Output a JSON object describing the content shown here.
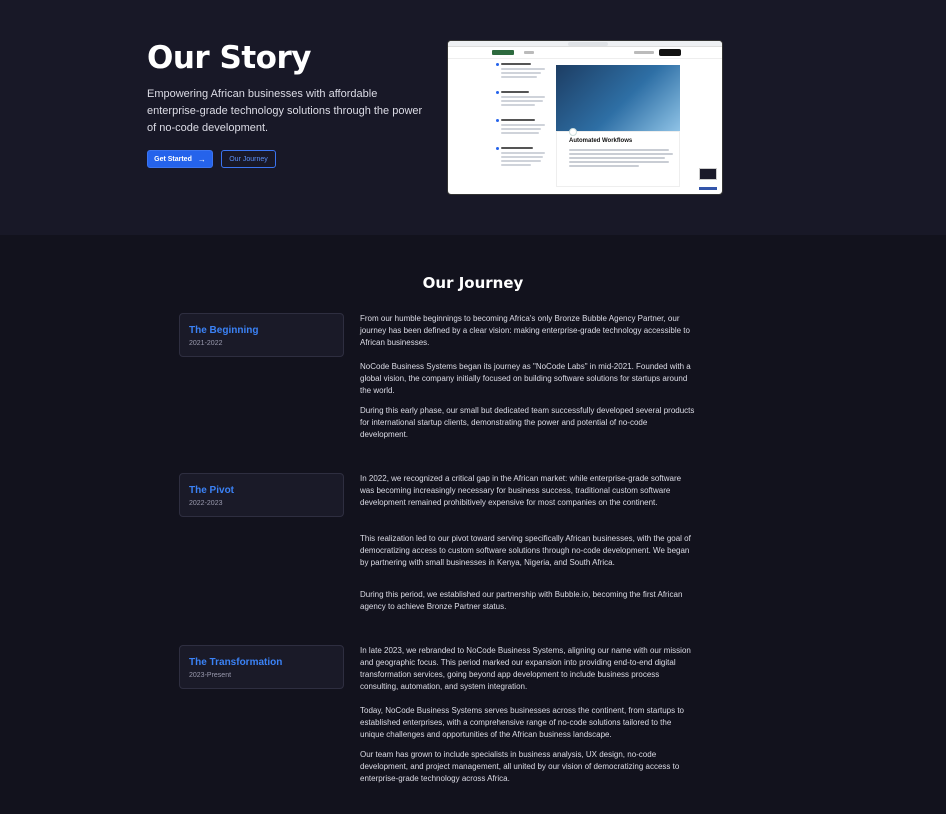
{
  "hero": {
    "title": "Our Story",
    "subtitle": "Empowering African businesses with affordable enterprise-grade technology solutions through the power of no-code development.",
    "primary_button": "Get Started",
    "secondary_button": "Our Journey",
    "preview_card_title": "Automated Workflows"
  },
  "journey": {
    "title": "Our Journey",
    "stages": [
      {
        "name": "The Beginning",
        "years": "2021-2022",
        "paragraphs": [
          "From our humble beginnings to becoming Africa's only Bronze Bubble Agency Partner, our journey has been defined by a clear vision: making enterprise-grade technology accessible to African businesses.",
          "NoCode Business Systems began its journey as \"NoCode Labs\" in mid-2021. Founded with a global vision, the company initially focused on building software solutions for startups around the world.",
          "During this early phase, our small but dedicated team successfully developed several products for international startup clients, demonstrating the power and potential of no-code development."
        ]
      },
      {
        "name": "The Pivot",
        "years": "2022-2023",
        "paragraphs": [
          "In 2022, we recognized a critical gap in the African market: while enterprise-grade software was becoming increasingly necessary for business success, traditional custom software development remained prohibitively expensive for most companies on the continent.",
          "This realization led to our pivot toward serving specifically African businesses, with the goal of democratizing access to custom software solutions through no-code development. We began by partnering with small businesses in Kenya, Nigeria, and South Africa.",
          "During this period, we established our partnership with Bubble.io, becoming the first African agency to achieve Bronze Partner status."
        ]
      },
      {
        "name": "The Transformation",
        "years": "2023-Present",
        "paragraphs": [
          "In late 2023, we rebranded to NoCode Business Systems, aligning our name with our mission and geographic focus. This period marked our expansion into providing end-to-end digital transformation services, going beyond app development to include business process consulting, automation, and system integration.",
          "Today, NoCode Business Systems serves businesses across the continent, from startups to established enterprises, with a comprehensive range of no-code solutions tailored to the unique challenges and opportunities of the African business landscape.",
          "Our team has grown to include specialists in business analysis, UX design, no-code development, and project management, all united by our vision of democratizing access to enterprise-grade technology across Africa."
        ]
      }
    ]
  },
  "icons": {
    "button_arrow": "arrow-right-icon"
  },
  "colors": {
    "accent": "#2563eb",
    "stage_name": "#3b82f6",
    "background": "#12121d",
    "hero_background": "#181827"
  }
}
